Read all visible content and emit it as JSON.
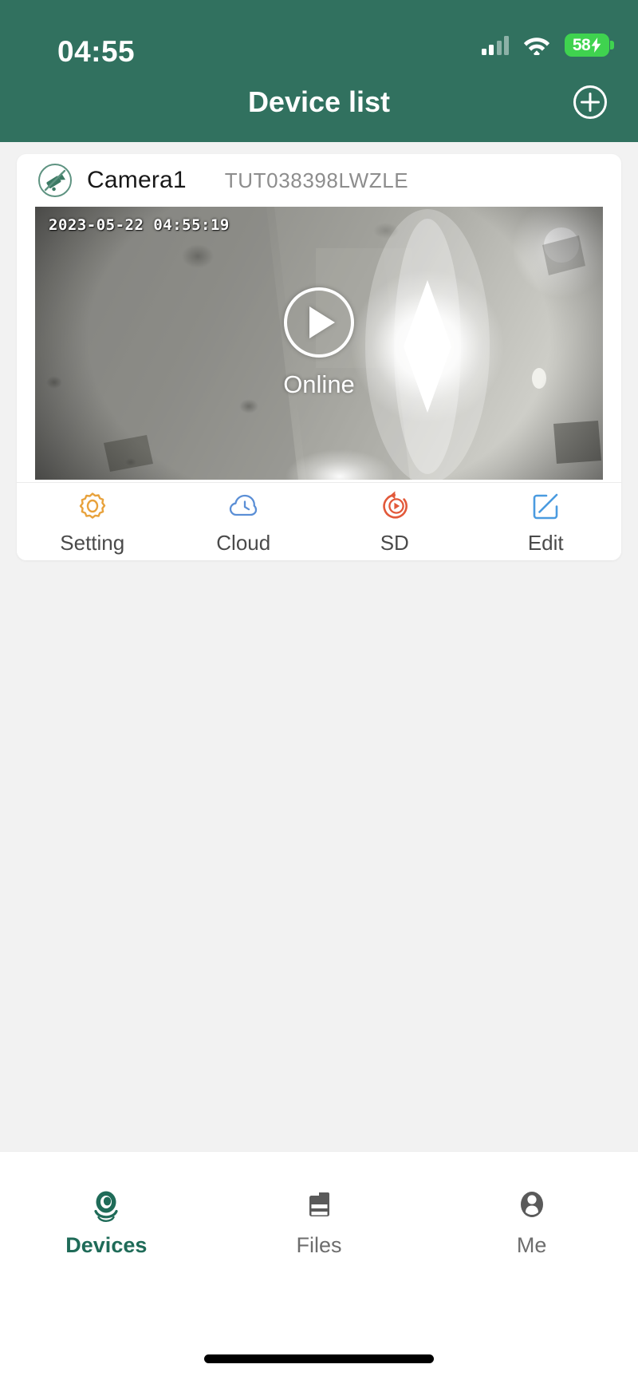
{
  "status_bar": {
    "time": "04:55",
    "signal_icon": "cellular-signal-icon",
    "wifi_icon": "wifi-icon",
    "battery_level": "58",
    "battery_icon": "battery-charging-icon",
    "battery_color": "#3fd34f"
  },
  "header": {
    "title": "Device list",
    "add_icon": "plus-circle-icon",
    "background_color": "#31715f"
  },
  "device": {
    "status_icon": "camera-disabled-icon",
    "name": "Camera1",
    "id": "TUT038398LWZLE",
    "video": {
      "timestamp": "2023-05-22 04:55:19",
      "play_icon": "play-icon",
      "status": "Online"
    },
    "actions": [
      {
        "label": "Setting",
        "icon": "gear-icon",
        "color": "#e8a23c"
      },
      {
        "label": "Cloud",
        "icon": "cloud-clock-icon",
        "color": "#5b8fd6"
      },
      {
        "label": "SD",
        "icon": "sd-playback-icon",
        "color": "#e2593a"
      },
      {
        "label": "Edit",
        "icon": "edit-pencil-icon",
        "color": "#4a9be0"
      }
    ]
  },
  "tabbar": {
    "items": [
      {
        "label": "Devices",
        "icon": "camera-eye-icon",
        "active": true
      },
      {
        "label": "Files",
        "icon": "folder-icon",
        "active": false
      },
      {
        "label": "Me",
        "icon": "person-icon",
        "active": false
      }
    ],
    "active_color": "#1f6b58",
    "inactive_color": "#6d6d6d"
  }
}
